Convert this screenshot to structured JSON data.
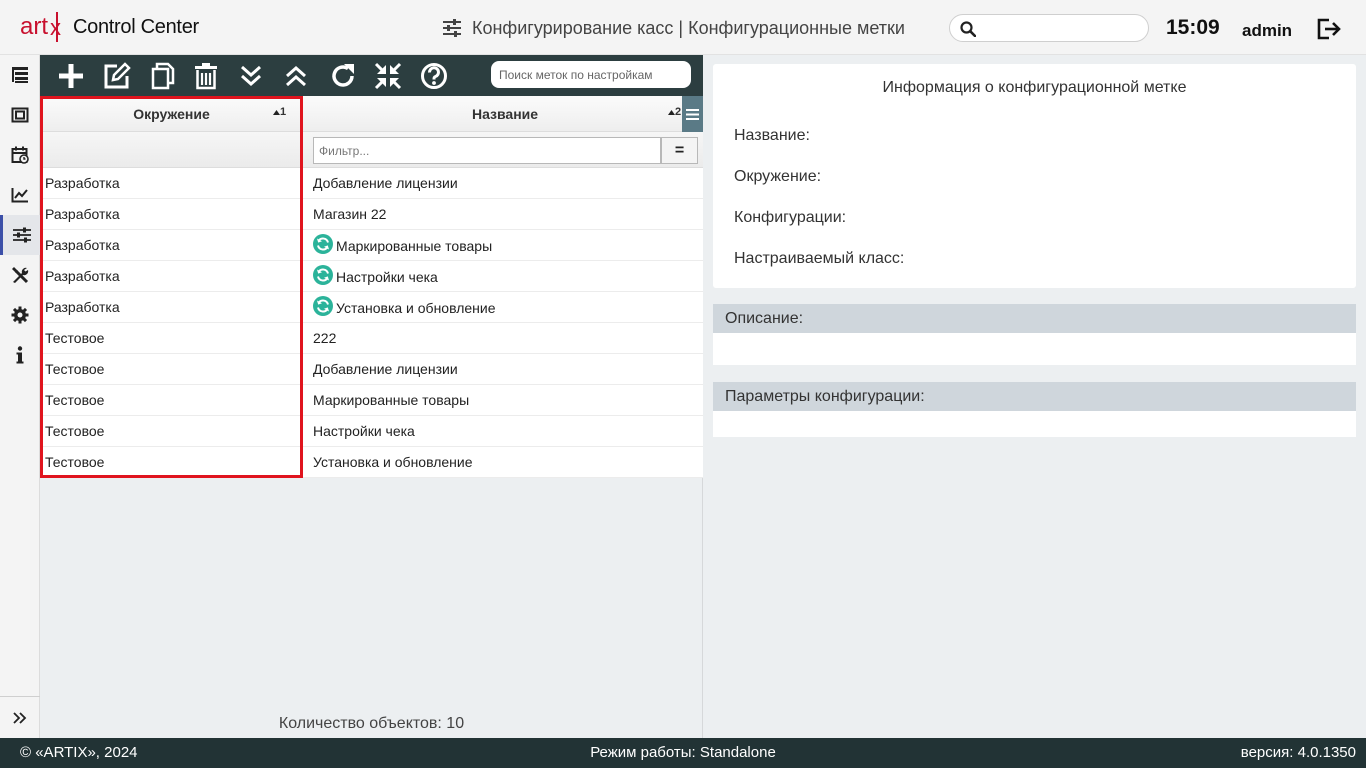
{
  "header": {
    "logo_text": "art",
    "logo_x": "x",
    "app_name": "Control Center",
    "page_title": "Конфигурирование касс | Конфигурационные метки",
    "search_placeholder": "",
    "time": "15:09",
    "user": "admin"
  },
  "nav": {
    "items": [
      {
        "icon": "tree-list-icon"
      },
      {
        "icon": "film-frame-icon"
      },
      {
        "icon": "calendar-clock-icon"
      },
      {
        "icon": "chart-line-icon"
      },
      {
        "icon": "sliders-icon",
        "active": true
      },
      {
        "icon": "tools-icon"
      },
      {
        "icon": "gear-icon"
      },
      {
        "icon": "info-icon"
      }
    ],
    "expand_icon": "chevrons-right-icon"
  },
  "toolbar": {
    "buttons": [
      "add-icon",
      "edit-icon",
      "copy-icon",
      "delete-icon",
      "expand-all-icon",
      "collapse-all-icon",
      "refresh-icon",
      "compress-icon",
      "help-icon"
    ],
    "search_placeholder": "Поиск меток по настройкам"
  },
  "grid": {
    "columns": [
      {
        "label": "Окружение",
        "sort": "1"
      },
      {
        "label": "Название",
        "sort": "2"
      }
    ],
    "filter_placeholder": "Фильтр...",
    "filter_button": "=",
    "rows": [
      {
        "env": "Разработка",
        "name": "Добавление лицензии",
        "synced": false
      },
      {
        "env": "Разработка",
        "name": "Магазин 22",
        "synced": false
      },
      {
        "env": "Разработка",
        "name": "Маркированные товары",
        "synced": true
      },
      {
        "env": "Разработка",
        "name": "Настройки чека",
        "synced": true
      },
      {
        "env": "Разработка",
        "name": "Установка и обновление",
        "synced": true
      },
      {
        "env": "Тестовое",
        "name": "222",
        "synced": false
      },
      {
        "env": "Тестовое",
        "name": "Добавление лицензии",
        "synced": false
      },
      {
        "env": "Тестовое",
        "name": "Маркированные товары",
        "synced": false
      },
      {
        "env": "Тестовое",
        "name": "Настройки чека",
        "synced": false
      },
      {
        "env": "Тестовое",
        "name": "Установка и обновление",
        "synced": false
      }
    ],
    "count_label": "Количество объектов: 10"
  },
  "info": {
    "title": "Информация о конфигурационной метке",
    "labels": [
      "Название:",
      "Окружение:",
      "Конфигурации:",
      "Настраиваемый класс:"
    ],
    "description_label": "Описание:",
    "params_label": "Параметры конфигурации:"
  },
  "footer": {
    "copyright": "© «ARTIX», 2024",
    "mode": "Режим работы: Standalone",
    "version": "версия: 4.0.1350"
  },
  "colors": {
    "toolbar_bg": "#2c3e40",
    "footer_bg": "#223335",
    "brand_red": "#c8102e",
    "highlight_red": "#e0141e",
    "sync_icon": "#2bb39a",
    "nav_active": "#3b4fa8"
  }
}
